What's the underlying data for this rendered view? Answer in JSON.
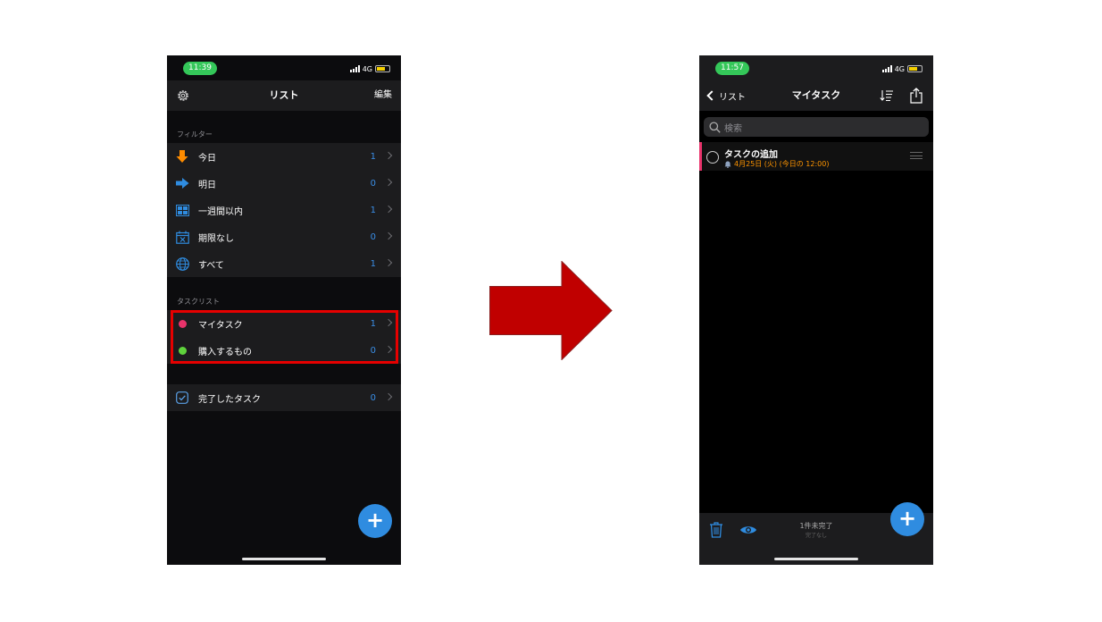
{
  "left_screen": {
    "status_time": "11:39",
    "network": "4G",
    "nav": {
      "title": "リスト",
      "edit_label": "編集"
    },
    "filter_section_label": "フィルター",
    "filters": [
      {
        "label": "今日",
        "count": "1",
        "icon": "down-arrow-icon"
      },
      {
        "label": "明日",
        "count": "0",
        "icon": "right-arrow-icon"
      },
      {
        "label": "一週間以内",
        "count": "1",
        "icon": "week-grid-icon"
      },
      {
        "label": "期限なし",
        "count": "0",
        "icon": "calendar-x-icon"
      },
      {
        "label": "すべて",
        "count": "1",
        "icon": "globe-icon"
      }
    ],
    "tasklist_section_label": "タスクリスト",
    "tasklists": [
      {
        "label": "マイタスク",
        "count": "1",
        "color": "#e8336b"
      },
      {
        "label": "購入するもの",
        "count": "0",
        "color": "#5fd33c"
      }
    ],
    "completed": {
      "label": "完了したタスク",
      "count": "0"
    },
    "fab_label": "+"
  },
  "right_screen": {
    "status_time": "11:57",
    "network": "4G",
    "nav": {
      "back_label": "リスト",
      "title": "マイタスク"
    },
    "search": {
      "placeholder": "検索"
    },
    "tasks": [
      {
        "title": "タスクの追加",
        "due": "4月25日 (火) (今日の 12:00)",
        "color": "#e8336b"
      }
    ],
    "bottom": {
      "pending_text": "1件未完了",
      "done_text": "完了なし"
    },
    "fab_label": "+"
  },
  "colors": {
    "accent_blue": "#2f8ce0",
    "highlight_red": "#e60000",
    "arrow_red": "#c00000",
    "due_orange": "#ff9500"
  }
}
